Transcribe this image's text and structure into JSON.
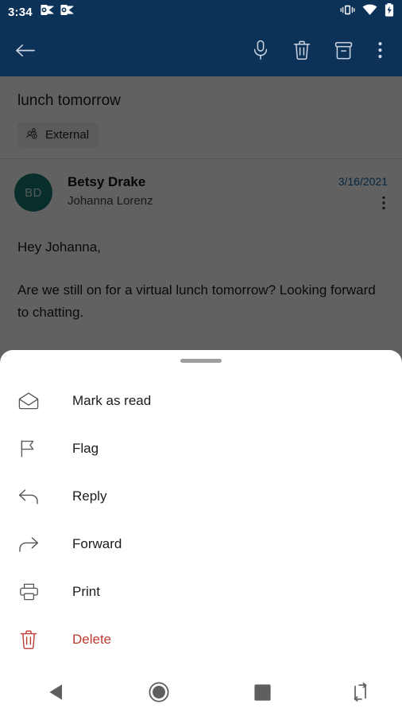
{
  "status_bar": {
    "clock": "3:34",
    "notification_icons": [
      "outlook-notification-icon",
      "outlook-notification-icon"
    ],
    "right_icons": [
      "vibrate-icon",
      "wifi-icon",
      "battery-charging-icon"
    ]
  },
  "toolbar": {
    "back_label": "Back",
    "actions": [
      {
        "name": "dictate-button",
        "icon": "microphone-icon"
      },
      {
        "name": "delete-button",
        "icon": "trash-icon"
      },
      {
        "name": "archive-button",
        "icon": "archive-icon"
      },
      {
        "name": "more-options-button",
        "icon": "kebab-menu-icon"
      }
    ]
  },
  "email": {
    "subject": "lunch tomorrow",
    "external_chip": "External",
    "avatar_initials": "BD",
    "sender": "Betsy Drake",
    "recipient": "Johanna Lorenz",
    "date": "3/16/2021",
    "body_paragraphs": [
      "Hey Johanna,",
      "Are we still on for a virtual lunch tomorrow? Looking forward to chatting."
    ]
  },
  "bottom_sheet": {
    "handle": "drag-handle",
    "items": [
      {
        "label": "Mark as read",
        "icon": "envelope-open-icon",
        "danger": false
      },
      {
        "label": "Flag",
        "icon": "flag-icon",
        "danger": false
      },
      {
        "label": "Reply",
        "icon": "reply-arrow-icon",
        "danger": false
      },
      {
        "label": "Forward",
        "icon": "forward-arrow-icon",
        "danger": false
      },
      {
        "label": "Print",
        "icon": "printer-icon",
        "danger": false
      },
      {
        "label": "Delete",
        "icon": "trash-icon",
        "danger": true
      }
    ]
  },
  "navigation_bar": {
    "buttons": [
      {
        "name": "nav-back-button",
        "icon": "triangle-back-icon"
      },
      {
        "name": "nav-home-button",
        "icon": "circle-home-icon"
      },
      {
        "name": "nav-recents-button",
        "icon": "square-recents-icon"
      },
      {
        "name": "nav-rotate-button",
        "icon": "rotate-screen-icon"
      }
    ]
  },
  "colors": {
    "app_bar": "#0d3258",
    "accent_blue": "#1464a5",
    "avatar_teal": "#157a74",
    "danger_red": "#bd3b31"
  }
}
